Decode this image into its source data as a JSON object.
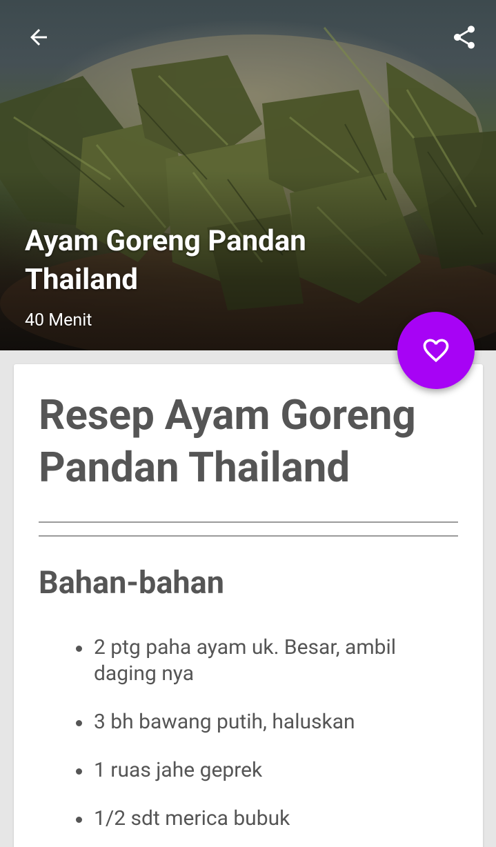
{
  "hero": {
    "title": "Ayam Goreng Pandan Thailand",
    "duration": "40 Menit"
  },
  "icons": {
    "back": "arrow-left-icon",
    "share": "share-icon",
    "favorite": "heart-outline-icon"
  },
  "colors": {
    "accent": "#a703f5",
    "text": "#555555",
    "background": "#e6e6e6"
  },
  "recipe": {
    "title": "Resep Ayam Goreng Pandan Thailand",
    "ingredients_heading": "Bahan-bahan",
    "ingredients": [
      "2 ptg paha ayam uk. Besar, ambil daging nya",
      "3 bh bawang putih, haluskan",
      "1 ruas jahe geprek",
      "1/2 sdt merica bubuk"
    ]
  }
}
